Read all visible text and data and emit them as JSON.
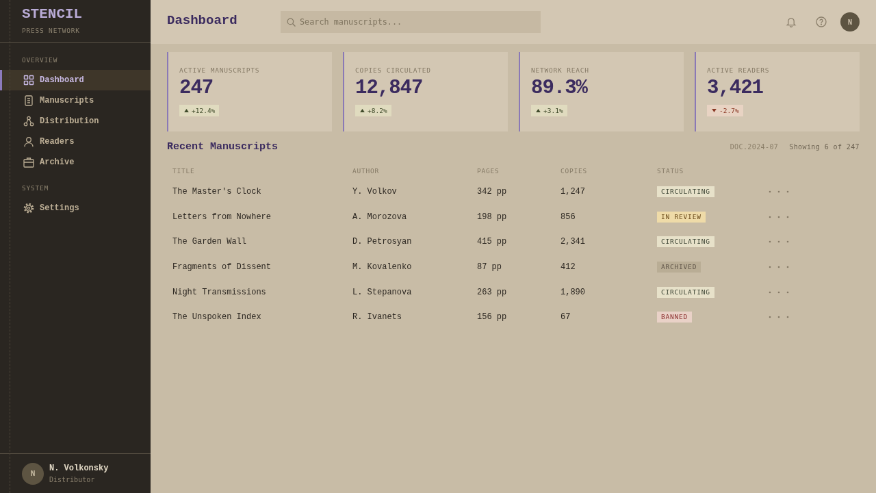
{
  "sidebar": {
    "logo": "STENCIL",
    "tagline": "PRESS NETWORK",
    "sections": [
      {
        "heading": "OVERVIEW",
        "items": [
          {
            "label": "Dashboard",
            "selected": true
          },
          {
            "label": "Manuscripts",
            "selected": false
          },
          {
            "label": "Distribution",
            "selected": false
          },
          {
            "label": "Readers",
            "selected": false
          },
          {
            "label": "Archive",
            "selected": false
          }
        ]
      },
      {
        "heading": "SYSTEM",
        "items": [
          {
            "label": "Settings",
            "selected": false
          }
        ]
      }
    ],
    "user": {
      "initial": "N",
      "name": "N. Volkonsky",
      "role": "Distributor"
    }
  },
  "header": {
    "title": "Dashboard",
    "search": {
      "placeholder": "Search manuscripts..."
    },
    "avatar": "N"
  },
  "stats": [
    {
      "label": "ACTIVE MANUSCRIPTS",
      "value": "247",
      "delta": {
        "kind": "up",
        "text": "+12.4%"
      }
    },
    {
      "label": "COPIES CIRCULATED",
      "value": "12,847",
      "delta": {
        "kind": "up",
        "text": "+8.2%"
      }
    },
    {
      "label": "NETWORK REACH",
      "value": "89.3%",
      "delta": {
        "kind": "up",
        "text": "+3.1%"
      }
    },
    {
      "label": "ACTIVE READERS",
      "value": "3,421",
      "delta": {
        "kind": "down",
        "text": "-2.7%"
      }
    }
  ],
  "recent": {
    "title": "Recent Manuscripts",
    "doc_code": "DOC.2024-07",
    "count": "Showing 6 of 247",
    "columns": [
      "TITLE",
      "AUTHOR",
      "PAGES",
      "COPIES",
      "STATUS"
    ],
    "rows": [
      {
        "title": "The Master's Clock",
        "author": "Y. Volkov",
        "pages": "342 pp",
        "copies": "1,247",
        "status": {
          "kind": "circulating",
          "label": "CIRCULATING"
        }
      },
      {
        "title": "Letters from Nowhere",
        "author": "A. Morozova",
        "pages": "198 pp",
        "copies": "856",
        "status": {
          "kind": "review",
          "label": "IN REVIEW"
        }
      },
      {
        "title": "The Garden Wall",
        "author": "D. Petrosyan",
        "pages": "415 pp",
        "copies": "2,341",
        "status": {
          "kind": "circulating",
          "label": "CIRCULATING"
        }
      },
      {
        "title": "Fragments of Dissent",
        "author": "M. Kovalenko",
        "pages": "87 pp",
        "copies": "412",
        "status": {
          "kind": "archived",
          "label": "ARCHIVED"
        }
      },
      {
        "title": "Night Transmissions",
        "author": "L. Stepanova",
        "pages": "263 pp",
        "copies": "1,890",
        "status": {
          "kind": "circulating",
          "label": "CIRCULATING"
        }
      },
      {
        "title": "The Unspoken Index",
        "author": "R. Ivanets",
        "pages": "156 pp",
        "copies": "67",
        "status": {
          "kind": "banned",
          "label": "BANNED"
        }
      }
    ]
  }
}
